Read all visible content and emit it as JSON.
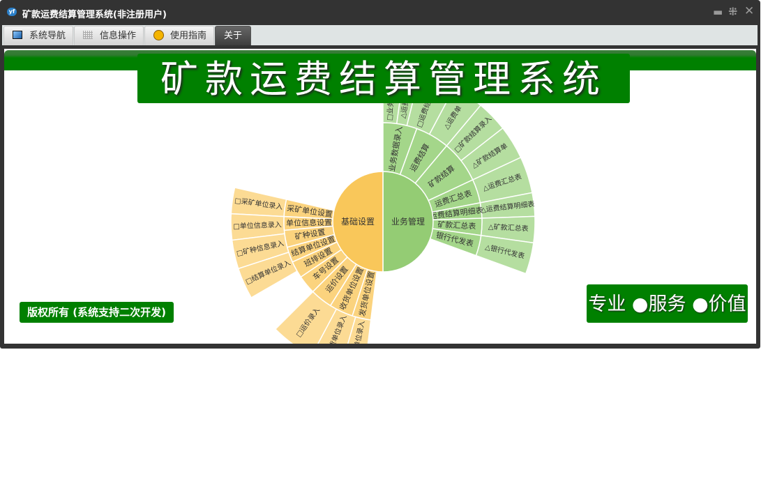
{
  "window": {
    "title": "矿款运费结算管理系统(非注册用户)",
    "logo_text": "yf"
  },
  "tabs": [
    {
      "label": "系统导航"
    },
    {
      "label": "信息操作"
    },
    {
      "label": "使用指南"
    },
    {
      "label": "关于"
    }
  ],
  "banner": "矿款运费结算管理系统",
  "copyright": "版权所有 (系统支持二次开发)",
  "slogan": "专业 ●服务 ●价值",
  "colors": {
    "green": "#008000",
    "sun_green_inner": "#94cc74",
    "sun_green_mid": "#a4d68a",
    "sun_green_outer": "#b5dea0",
    "sun_orange_inner": "#f9c75a",
    "sun_orange_mid": "#fbd37e",
    "sun_orange_outer": "#fcdb94"
  },
  "sunburst": {
    "roots": [
      {
        "label": "业务管理",
        "group": "green",
        "a0": -90,
        "a1": 90
      },
      {
        "label": "基础设置",
        "group": "orange",
        "a0": 90,
        "a1": 270
      }
    ],
    "middle": [
      {
        "label": "业务数据录入",
        "group": "green",
        "a0": -90,
        "a1": -70
      },
      {
        "label": "运费结算",
        "group": "green",
        "a0": -70,
        "a1": -50
      },
      {
        "label": "矿款结算",
        "group": "green",
        "a0": -50,
        "a1": -25
      },
      {
        "label": "运费汇总表",
        "group": "green",
        "a0": -25,
        "a1": -11
      },
      {
        "label": "运费结算明细表",
        "group": "green",
        "a0": -11,
        "a1": -2
      },
      {
        "label": "矿款汇总表",
        "group": "green",
        "a0": -2,
        "a1": 8
      },
      {
        "label": "银行代发表",
        "group": "green",
        "a0": 8,
        "a1": 20
      },
      {
        "label": "采矿单位设置",
        "group": "orange",
        "a0": 183,
        "a1": 193
      },
      {
        "label": "单位信息设置",
        "group": "orange",
        "a0": 175,
        "a1": 183
      },
      {
        "label": "矿种设置",
        "group": "orange",
        "a0": 165,
        "a1": 175
      },
      {
        "label": "结算单位设置",
        "group": "orange",
        "a0": 156,
        "a1": 165
      },
      {
        "label": "班排设置",
        "group": "orange",
        "a0": 146,
        "a1": 156
      },
      {
        "label": "车号设置",
        "group": "orange",
        "a0": 135,
        "a1": 146
      },
      {
        "label": "运价设置",
        "group": "orange",
        "a0": 122,
        "a1": 135
      },
      {
        "label": "收货单位设置",
        "group": "orange",
        "a0": 108,
        "a1": 122
      },
      {
        "label": "发货单位设置",
        "group": "orange",
        "a0": 97,
        "a1": 108
      }
    ],
    "outer": [
      {
        "label": "□业务数据录入",
        "group": "green",
        "a0": -90,
        "a1": -82
      },
      {
        "label": "△运费数据单",
        "group": "green",
        "a0": -82,
        "a1": -76
      },
      {
        "label": "□运费结算录入",
        "group": "green",
        "a0": -76,
        "a1": -62
      },
      {
        "label": "△运费单",
        "group": "green",
        "a0": -62,
        "a1": -50
      },
      {
        "label": "□矿款结算录入",
        "group": "green",
        "a0": -50,
        "a1": -38
      },
      {
        "label": "△矿款结算单",
        "group": "green",
        "a0": -38,
        "a1": -25
      },
      {
        "label": "△运费汇总表",
        "group": "green",
        "a0": -25,
        "a1": -11
      },
      {
        "label": "△运费结算明细表",
        "group": "green",
        "a0": -11,
        "a1": -2
      },
      {
        "label": "△矿款汇总表",
        "group": "green",
        "a0": -2,
        "a1": 8
      },
      {
        "label": "△银行代发表",
        "group": "green",
        "a0": 8,
        "a1": 20
      },
      {
        "label": "□采矿单位录入",
        "group": "orange",
        "a0": 183,
        "a1": 193
      },
      {
        "label": "□单位信息录入",
        "group": "orange",
        "a0": 173,
        "a1": 183
      },
      {
        "label": "□矿种信息录入",
        "group": "orange",
        "a0": 162,
        "a1": 173
      },
      {
        "label": "□结算单位录入",
        "group": "orange",
        "a0": 150,
        "a1": 162
      },
      {
        "label": "□运价录入",
        "group": "orange",
        "a0": 118,
        "a1": 135
      },
      {
        "label": "□收货单位录入",
        "group": "orange",
        "a0": 106,
        "a1": 118
      },
      {
        "label": "□发货单位录入",
        "group": "orange",
        "a0": 97,
        "a1": 106
      }
    ]
  }
}
